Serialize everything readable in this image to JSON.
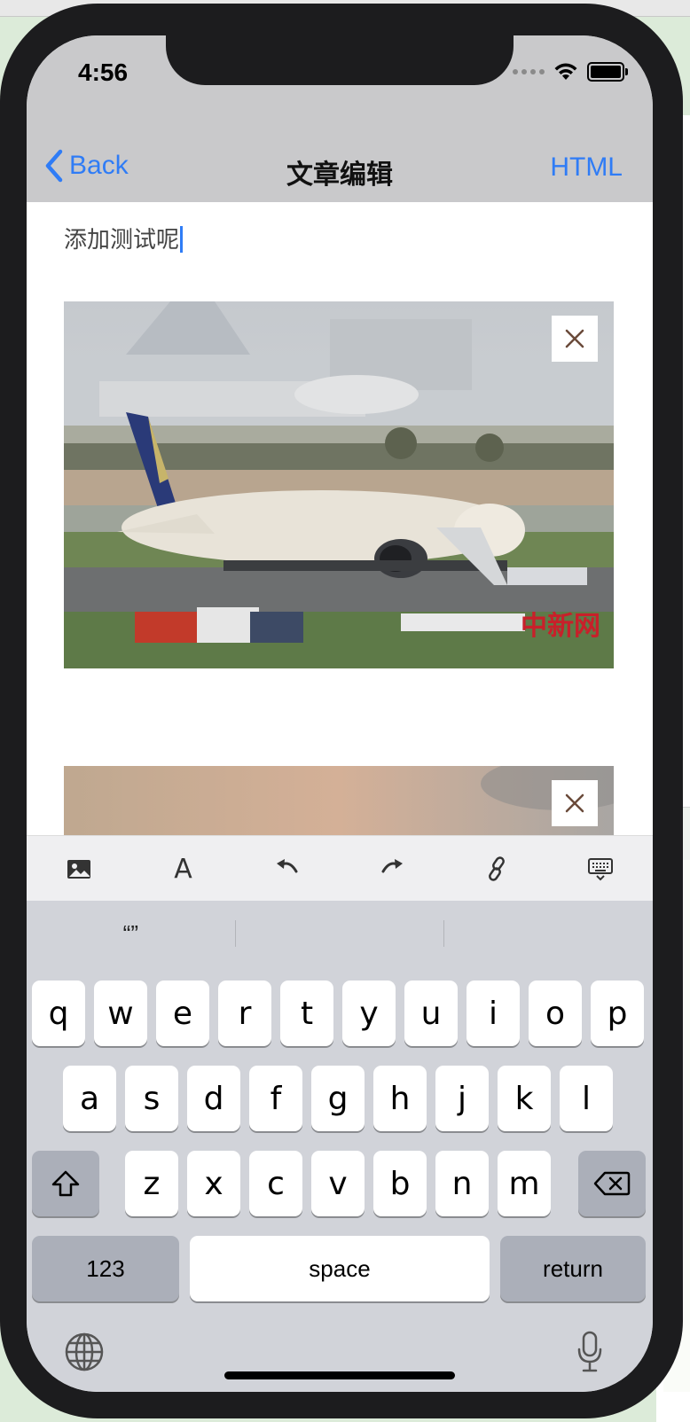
{
  "status": {
    "time": "4:56"
  },
  "nav": {
    "back_label": "Back",
    "title": "文章编辑",
    "html_label": "HTML"
  },
  "editor": {
    "text": "添加测试呢"
  },
  "suggestions": [
    "“”",
    "",
    ""
  ],
  "keyboard": {
    "row1": [
      "q",
      "w",
      "e",
      "r",
      "t",
      "y",
      "u",
      "i",
      "o",
      "p"
    ],
    "row2": [
      "a",
      "s",
      "d",
      "f",
      "g",
      "h",
      "j",
      "k",
      "l"
    ],
    "row3": [
      "z",
      "x",
      "c",
      "v",
      "b",
      "n",
      "m"
    ],
    "numbers_label": "123",
    "space_label": "space",
    "return_label": "return"
  },
  "toolbar": {
    "font_label": "A"
  },
  "colors": {
    "accent": "#2f7cf6",
    "keyboard_bg": "#d1d3d9",
    "nav_bg": "#c9c9cb"
  },
  "icons": [
    "image-icon",
    "font-icon",
    "undo-icon",
    "redo-icon",
    "link-icon",
    "keyboard-dismiss-icon",
    "close-icon",
    "shift-icon",
    "delete-icon",
    "globe-icon",
    "microphone-icon"
  ]
}
